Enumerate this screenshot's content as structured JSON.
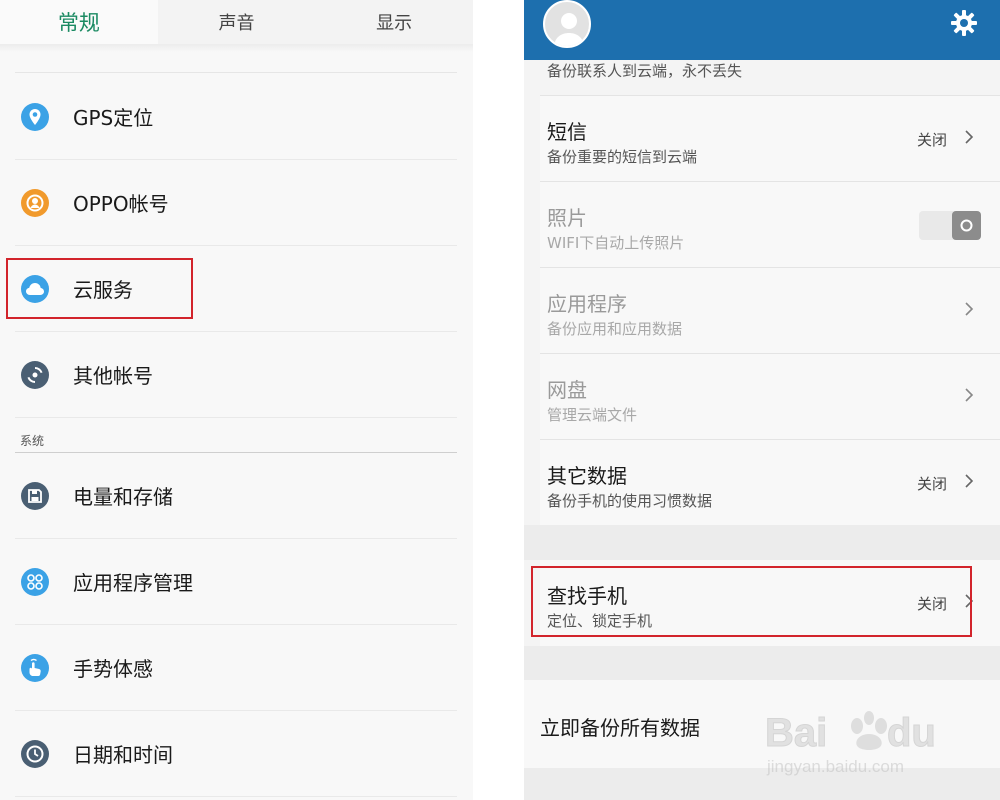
{
  "tabs": [
    {
      "label": "常规",
      "active": true
    },
    {
      "label": "声音",
      "active": false
    },
    {
      "label": "显示",
      "active": false
    }
  ],
  "left_items": [
    {
      "label": "GPS定位",
      "icon": "location-pin-icon",
      "color": "#3ba2e6"
    },
    {
      "label": "OPPO帐号",
      "icon": "account-icon",
      "color": "#f19a2c"
    },
    {
      "label": "云服务",
      "icon": "cloud-icon",
      "color": "#3ba2e6"
    },
    {
      "label": "其他帐号",
      "icon": "sync-icon",
      "color": "#4a5f73"
    }
  ],
  "section_label": "系统",
  "system_items": [
    {
      "label": "电量和存储",
      "icon": "storage-icon",
      "color": "#4a5f73"
    },
    {
      "label": "应用程序管理",
      "icon": "apps-icon",
      "color": "#3ba2e6"
    },
    {
      "label": "手势体感",
      "icon": "gesture-icon",
      "color": "#3ba2e6"
    },
    {
      "label": "日期和时间",
      "icon": "clock-icon",
      "color": "#4a5f73"
    }
  ],
  "right": {
    "top_subtitle": "备份联系人到云端，永不丢失",
    "rows": [
      {
        "title": "短信",
        "subtitle": "备份重要的短信到云端",
        "status": "关闭",
        "control": "chevron",
        "dim": false
      },
      {
        "title": "照片",
        "subtitle": "WIFI下自动上传照片",
        "status": "",
        "control": "toggle",
        "dim": true
      },
      {
        "title": "应用程序",
        "subtitle": "备份应用和应用数据",
        "status": "",
        "control": "chevron",
        "dim": true
      },
      {
        "title": "网盘",
        "subtitle": "管理云端文件",
        "status": "",
        "control": "chevron",
        "dim": true
      },
      {
        "title": "其它数据",
        "subtitle": "备份手机的使用习惯数据",
        "status": "关闭",
        "control": "chevron",
        "dim": false
      }
    ],
    "find_phone": {
      "title": "查找手机",
      "subtitle": "定位、锁定手机",
      "status": "关闭"
    },
    "backup_all": "立即备份所有数据"
  },
  "colors": {
    "accent_green": "#1b8a62",
    "header_blue": "#1d6fae",
    "highlight_red": "#d2242b"
  }
}
